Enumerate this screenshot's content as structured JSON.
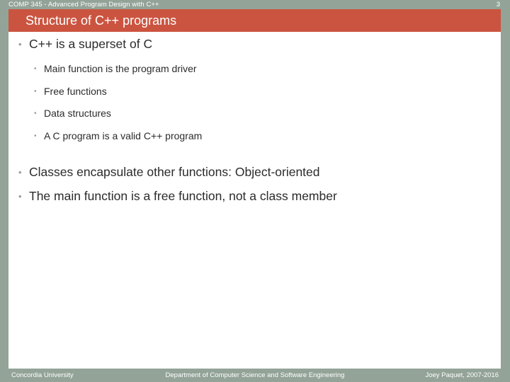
{
  "slide": {
    "course_label": "COMP 345 - Advanced Program Design with C++",
    "slide_number": "3",
    "title": "Structure of C++ programs",
    "colors": {
      "accent_red": "#cb5440",
      "band_green": "#93a398",
      "body_text": "#2b2b2b",
      "bullet_marker": "#9b9b9b",
      "header_text": "#ffffff"
    }
  },
  "body": {
    "bullets": [
      {
        "level": 1,
        "marker": "•",
        "text": "C++ is a superset of C"
      },
      {
        "level": 2,
        "marker": "•",
        "text": "Main function is the program driver"
      },
      {
        "level": 2,
        "marker": "•",
        "text": "Free functions"
      },
      {
        "level": 2,
        "marker": "•",
        "text": "Data structures"
      },
      {
        "level": 2,
        "marker": "•",
        "text": "A C program is a valid C++ program"
      },
      {
        "level": 1,
        "marker": "•",
        "text": "Classes encapsulate other functions: Object-oriented"
      },
      {
        "level": 1,
        "marker": "•",
        "text": "The main function is a free function, not a class member"
      }
    ]
  },
  "footer": {
    "left": "Concordia University",
    "center": "Department of Computer Science and Software Engineering",
    "right": "Joey Paquet, 2007-2016"
  }
}
